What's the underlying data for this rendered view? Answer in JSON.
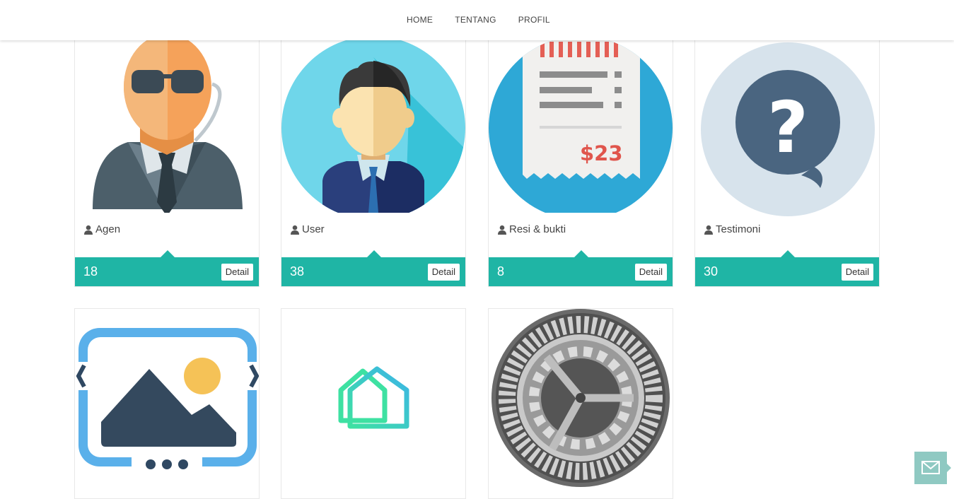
{
  "nav": {
    "items": [
      "HOME",
      "TENTANG",
      "PROFIL"
    ]
  },
  "cards": [
    {
      "label": "Agen",
      "count": "18",
      "button": "Detail",
      "icon": "security-agent-icon"
    },
    {
      "label": "User",
      "count": "38",
      "button": "Detail",
      "icon": "businessman-icon"
    },
    {
      "label": "Resi & bukti",
      "count": "8",
      "button": "Detail",
      "icon": "receipt-icon"
    },
    {
      "label": "Testimoni",
      "count": "30",
      "button": "Detail",
      "icon": "question-bubble-icon"
    }
  ],
  "tiles": [
    {
      "icon": "image-gallery-icon"
    },
    {
      "icon": "home-icon"
    },
    {
      "icon": "settings-gear-icon"
    }
  ],
  "receipt_amount": "$23",
  "chat": {
    "icon": "envelope-icon"
  },
  "colors": {
    "accent": "#1fb5a5",
    "chat_button": "#8fc9c2"
  }
}
